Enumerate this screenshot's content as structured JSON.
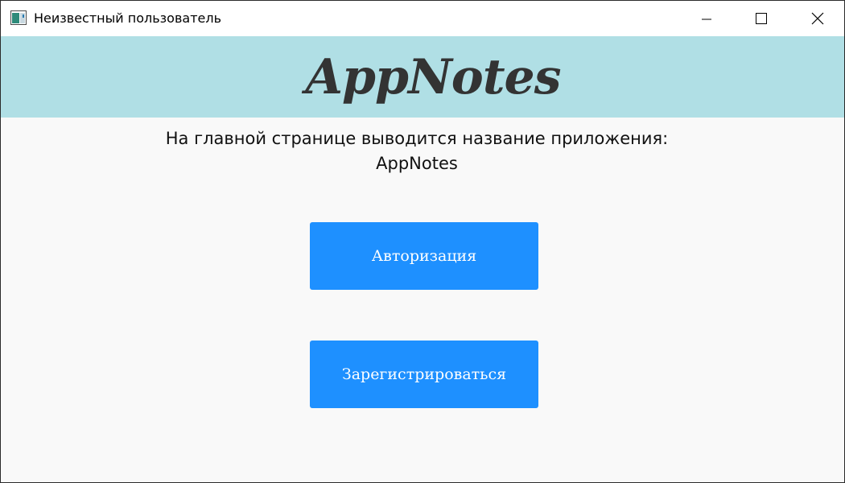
{
  "window": {
    "title": "Неизвестный пользователь",
    "icon": "app-window-icon",
    "controls": [
      "minimize-icon",
      "maximize-icon",
      "close-icon"
    ]
  },
  "header": {
    "app_name": "AppNotes",
    "background_color": "#b0dfe5"
  },
  "main": {
    "description_line1": "На главной странице выводится название приложения:",
    "description_line2": "AppNotes",
    "login_button": "Авторизация",
    "register_button": "Зарегистрироваться",
    "button_color": "#1e90ff"
  }
}
